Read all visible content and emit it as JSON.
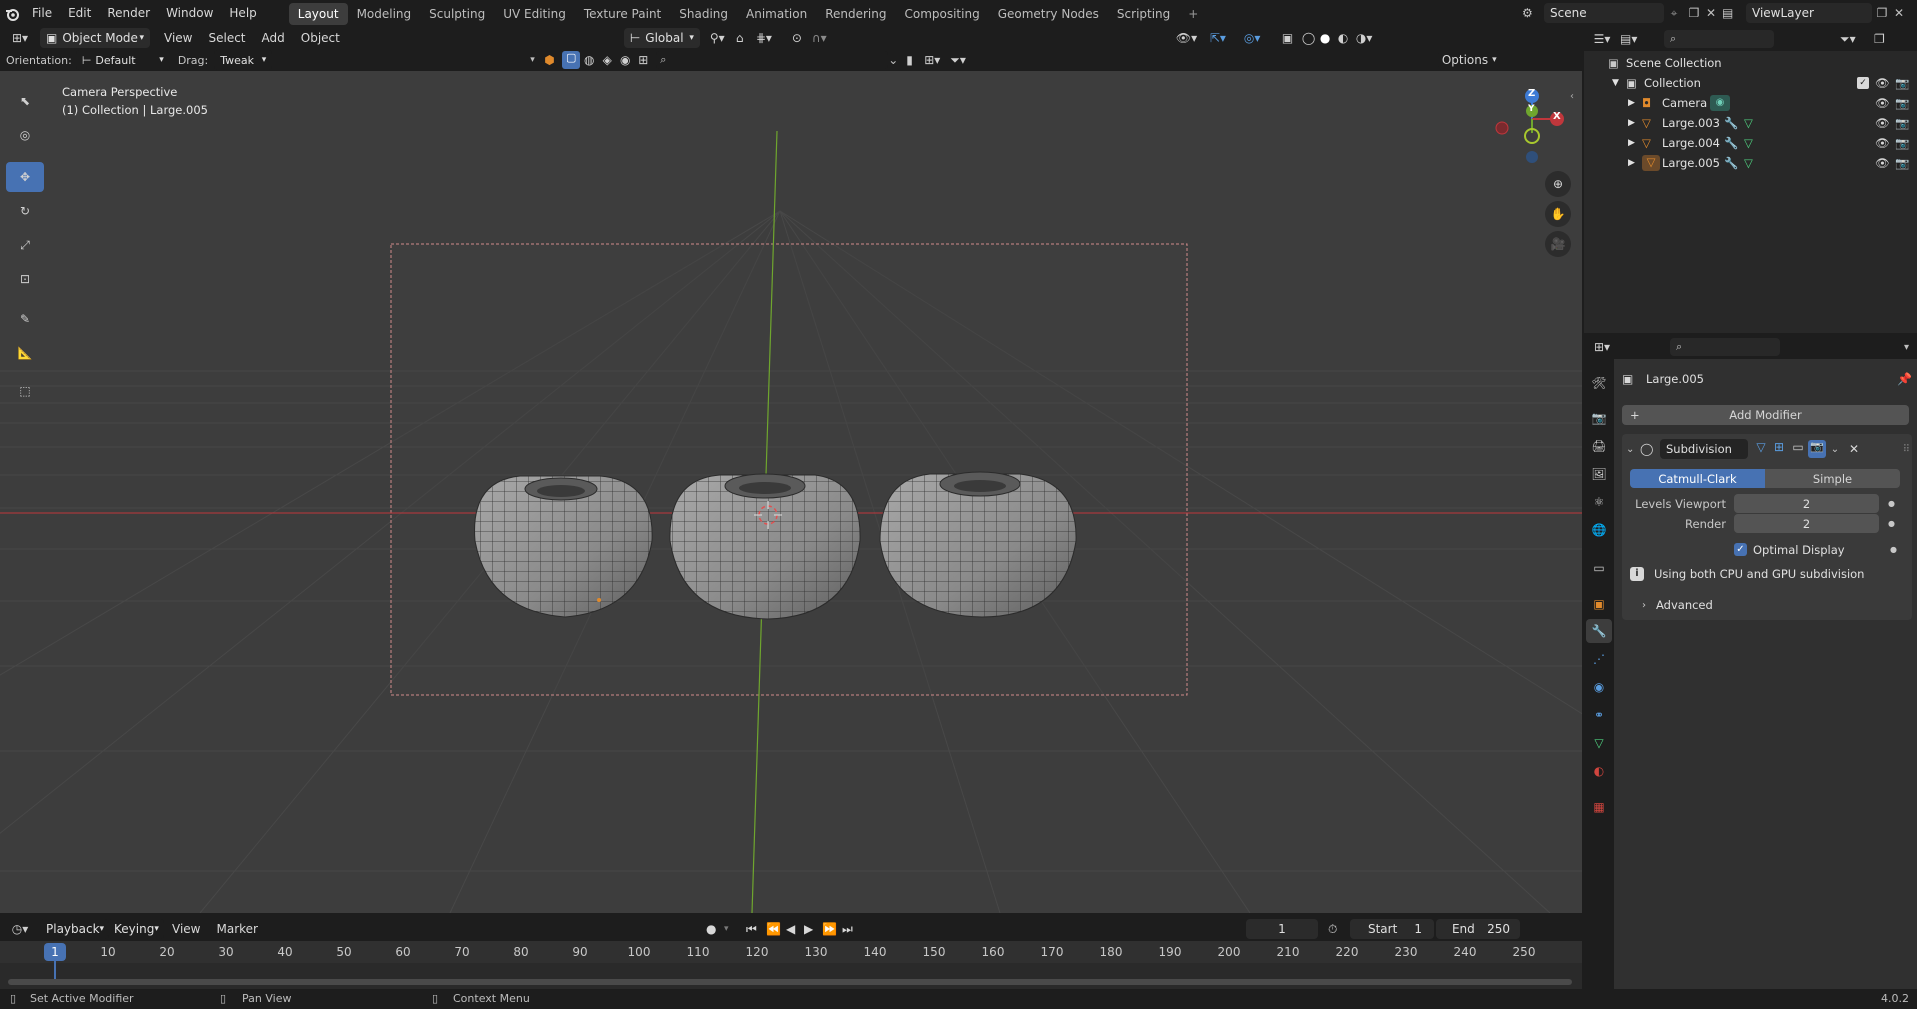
{
  "menubar": {
    "items": [
      "File",
      "Edit",
      "Render",
      "Window",
      "Help"
    ],
    "workspaces": [
      "Layout",
      "Modeling",
      "Sculpting",
      "UV Editing",
      "Texture Paint",
      "Shading",
      "Animation",
      "Rendering",
      "Compositing",
      "Geometry Nodes",
      "Scripting"
    ],
    "active_workspace": "Layout",
    "add_tab": "+",
    "scene": "Scene",
    "view_layer": "ViewLayer"
  },
  "viewport_header": {
    "mode": "Object Mode",
    "menus": [
      "View",
      "Select",
      "Add",
      "Object"
    ],
    "transform_orientation": "Global",
    "options": "Options"
  },
  "tool_settings": {
    "orientation_label": "Orientation:",
    "orientation_value": "Default",
    "drag_label": "Drag:",
    "drag_value": "Tweak"
  },
  "viewport": {
    "overlay_line1": "Camera Perspective",
    "overlay_line2": "(1) Collection | Large.005",
    "gizmo_z": "Z",
    "gizmo_y": "Y",
    "gizmo_x": "X"
  },
  "outliner": {
    "scene_collection": "Scene Collection",
    "collection": "Collection",
    "objects": [
      "Camera",
      "Large.003",
      "Large.004",
      "Large.005"
    ],
    "active_object": "Large.005"
  },
  "properties": {
    "object_name": "Large.005",
    "add_modifier": "Add Modifier",
    "modifier_name": "Subdivision",
    "algorithm_options": [
      "Catmull-Clark",
      "Simple"
    ],
    "algorithm_selected": "Catmull-Clark",
    "levels_viewport_label": "Levels Viewport",
    "levels_viewport_value": "2",
    "render_label": "Render",
    "render_value": "2",
    "optimal_display_label": "Optimal Display",
    "optimal_display_checked": true,
    "info_text": "Using both CPU and GPU subdivision",
    "advanced_label": "Advanced"
  },
  "timeline": {
    "menus": [
      "Playback",
      "Keying",
      "View",
      "Marker"
    ],
    "current_frame": "1",
    "start_label": "Start",
    "start_value": "1",
    "end_label": "End",
    "end_value": "250",
    "ticks": [
      "10",
      "20",
      "30",
      "40",
      "50",
      "60",
      "70",
      "80",
      "90",
      "100",
      "110",
      "120",
      "130",
      "140",
      "150",
      "160",
      "170",
      "180",
      "190",
      "200",
      "210",
      "220",
      "230",
      "240",
      "250"
    ],
    "playhead_label": "1"
  },
  "statusbar": {
    "hint1": "Set Active Modifier",
    "hint2": "Pan View",
    "hint3": "Context Menu",
    "version": "4.0.2"
  },
  "colors": {
    "accent": "#4772b3",
    "background": "#1d1d1d",
    "panel": "#303030",
    "viewport": "#3d3d3d",
    "object_orange": "#e08a2c",
    "axis_x": "#c0373c",
    "axis_y": "#6fa62e",
    "axis_z": "#3d7bd5"
  }
}
